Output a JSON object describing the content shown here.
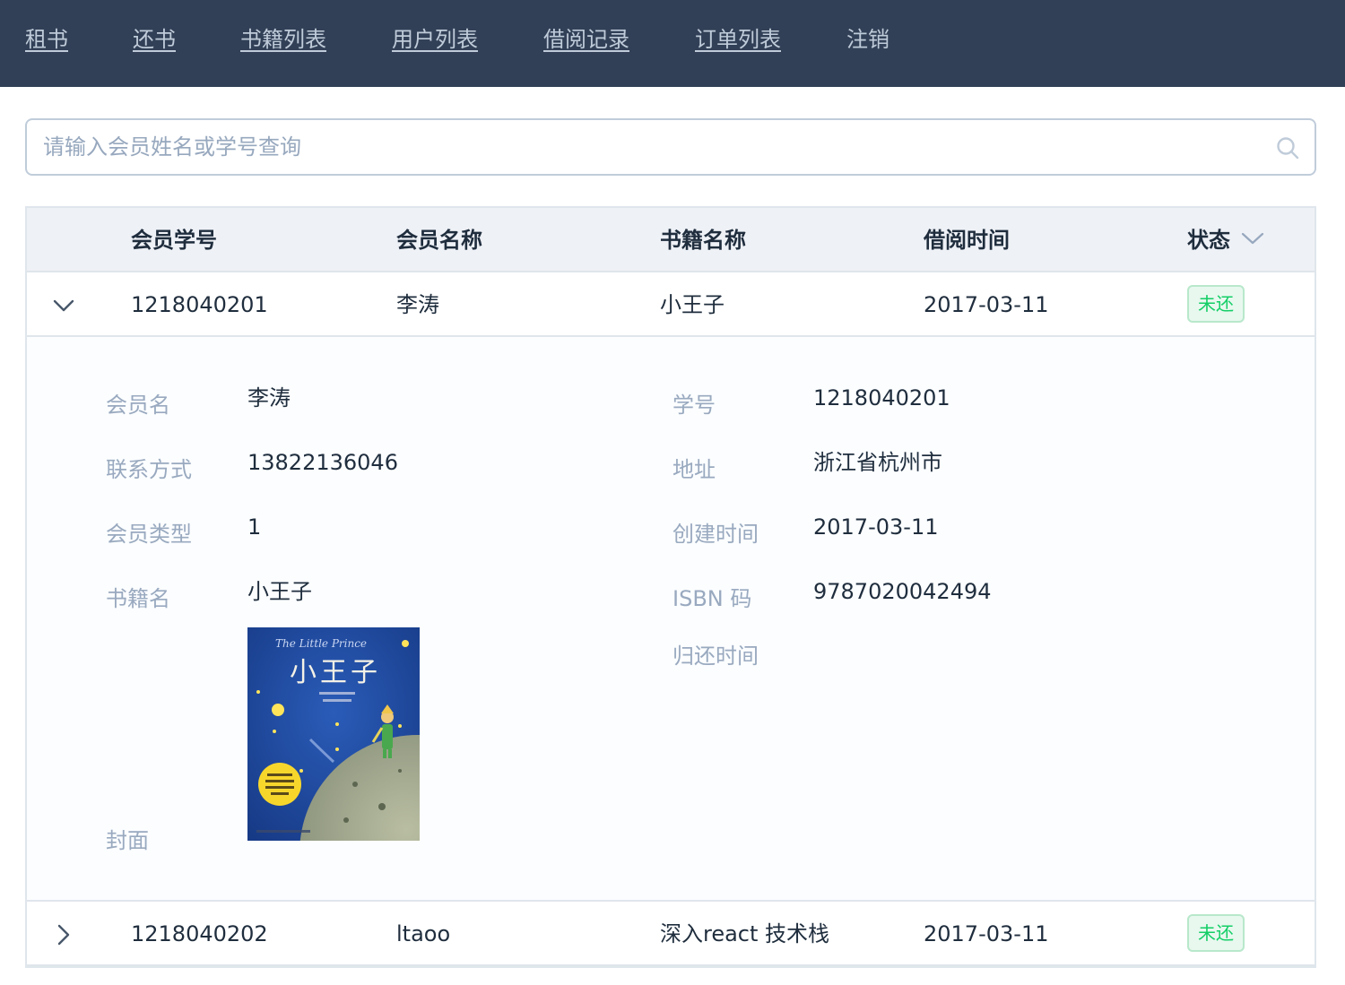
{
  "nav": {
    "items": [
      "租书",
      "还书",
      "书籍列表",
      "用户列表",
      "借阅记录",
      "订单列表",
      "注销"
    ]
  },
  "search": {
    "placeholder": "请输入会员姓名或学号查询",
    "icon": "search-icon"
  },
  "table": {
    "headers": [
      "会员学号",
      "会员名称",
      "书籍名称",
      "借阅时间",
      "状态"
    ],
    "rows": [
      {
        "id": "1218040201",
        "name": "李涛",
        "book": "小王子",
        "date": "2017-03-11",
        "status": "未还",
        "expanded": true
      },
      {
        "id": "1218040202",
        "name": "ltaoo",
        "book": "深入react 技术栈",
        "date": "2017-03-11",
        "status": "未还",
        "expanded": false
      }
    ],
    "detail": {
      "member_name_label": "会员名",
      "member_name": "李涛",
      "contact_label": "联系方式",
      "contact": "13822136046",
      "member_type_label": "会员类型",
      "member_type": "1",
      "book_name_label": "书籍名",
      "book_name": "小王子",
      "cover_label": "封面",
      "cover_title_en": "The Little Prince",
      "cover_title_cn": "小王子",
      "student_id_label": "学号",
      "student_id": "1218040201",
      "address_label": "地址",
      "address": "浙江省杭州市",
      "created_label": "创建时间",
      "created": "2017-03-11",
      "isbn_label": "ISBN 码",
      "isbn": "9787020042494",
      "return_label": "归还时间",
      "return_time": ""
    }
  },
  "colors": {
    "nav_bg": "#324057",
    "nav_text": "#bfcbd9",
    "tag_green": "#13ce66",
    "label_gray": "#99a9bf"
  }
}
